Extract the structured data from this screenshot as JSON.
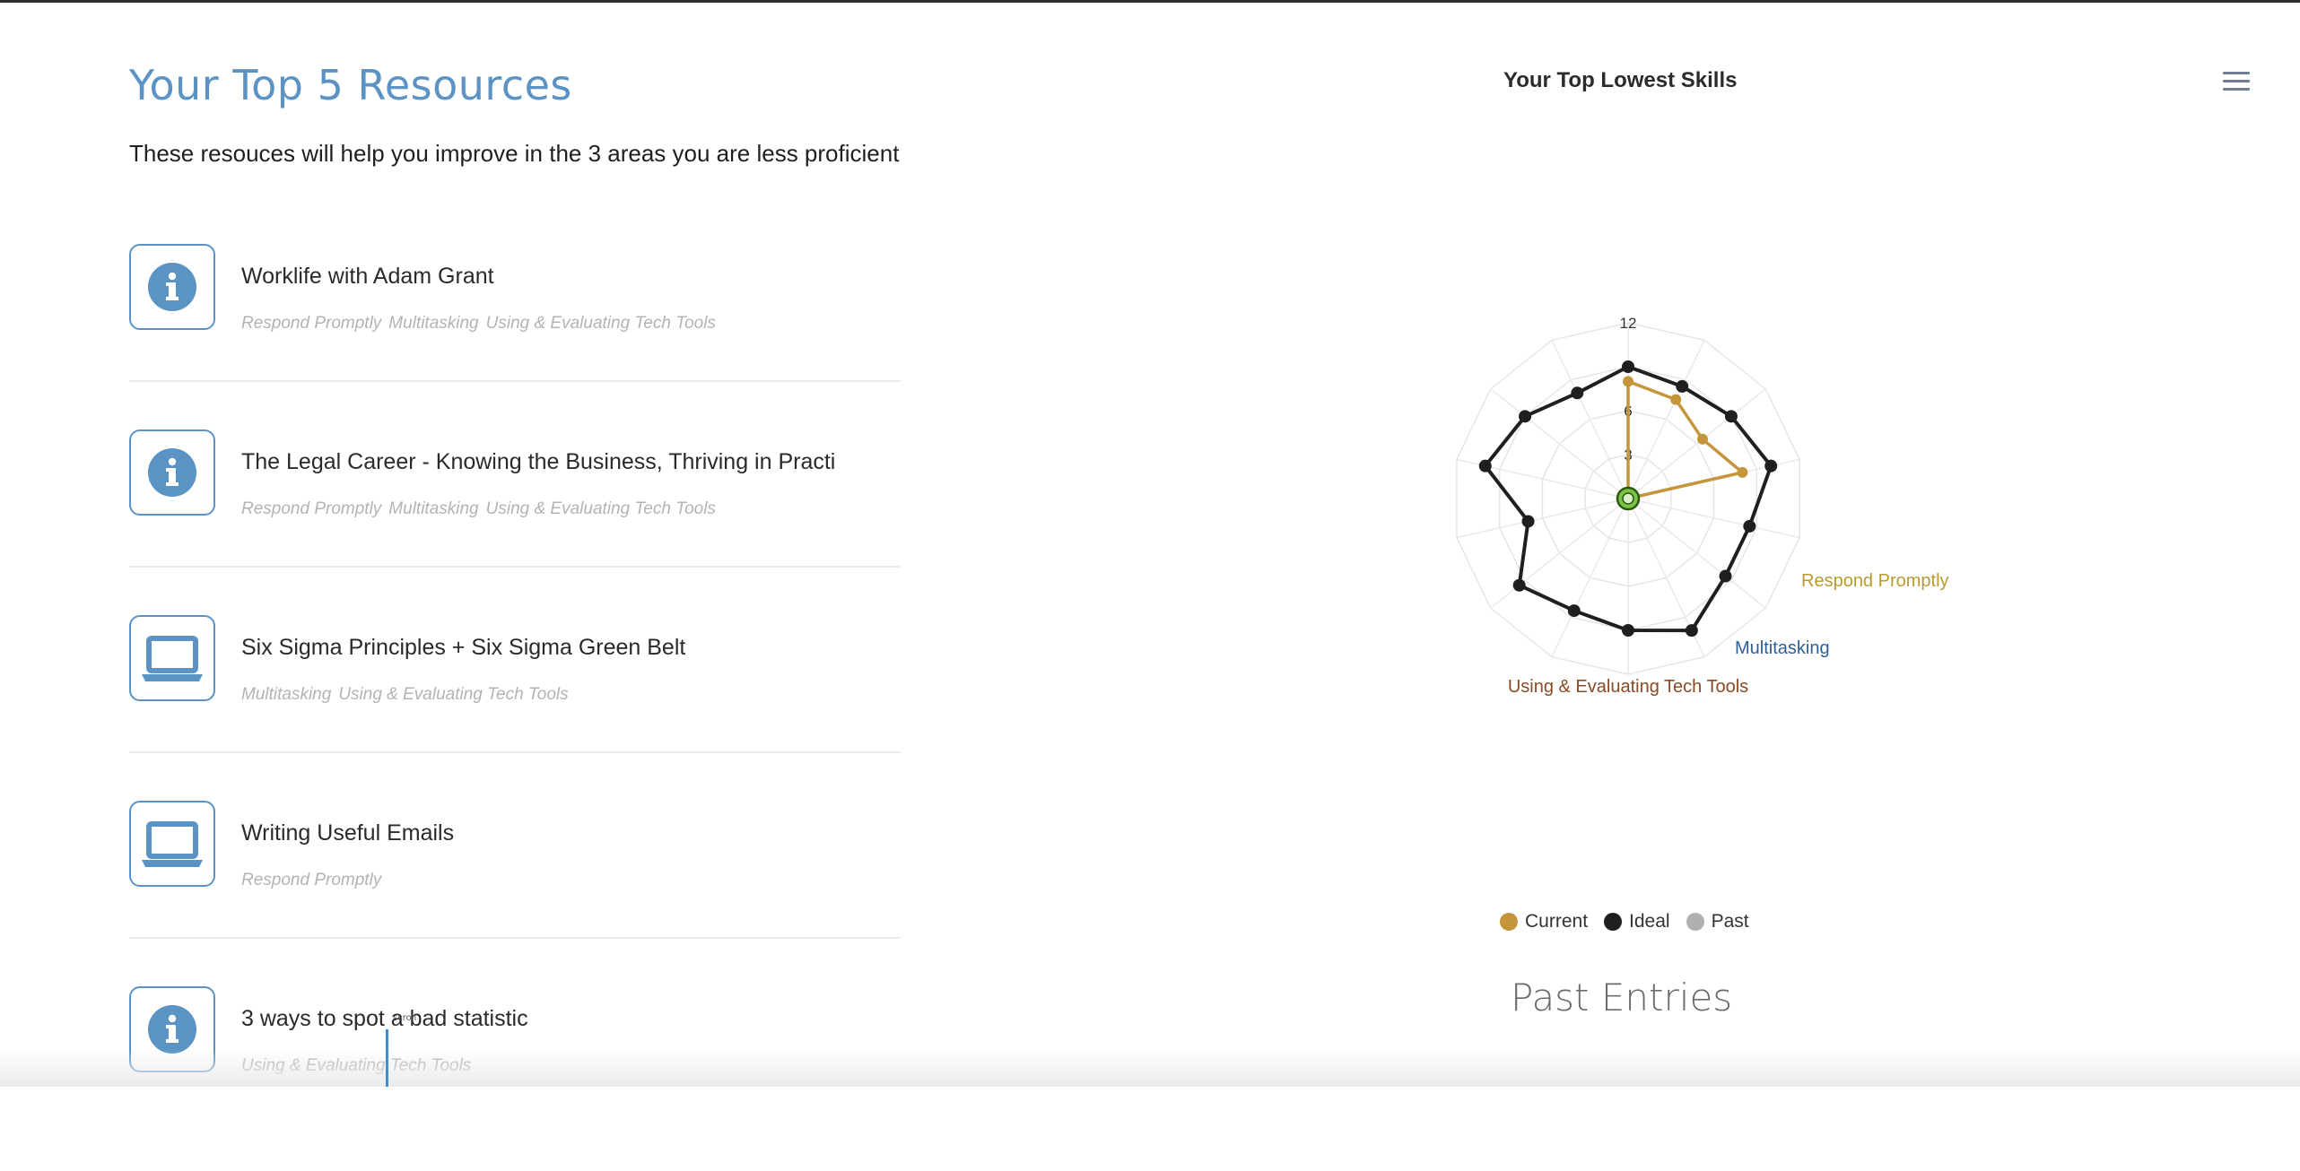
{
  "resources_section": {
    "heading": "Your Top 5 Resources",
    "subheading": "These resouces will help you improve in the 3 areas you are less proficient",
    "items": [
      {
        "icon": "info-icon",
        "title": "Worklife with Adam Grant",
        "tags": [
          "Respond Promptly",
          "Multitasking",
          "Using & Evaluating Tech Tools"
        ]
      },
      {
        "icon": "info-icon",
        "title": "The Legal Career - Knowing the Business, Thriving in Practi",
        "tags": [
          "Respond Promptly",
          "Multitasking",
          "Using & Evaluating Tech Tools"
        ]
      },
      {
        "icon": "laptop-icon",
        "title": "Six Sigma Principles + Six Sigma Green Belt",
        "tags": [
          "Multitasking",
          "Using & Evaluating Tech Tools"
        ]
      },
      {
        "icon": "laptop-icon",
        "title": "Writing Useful Emails",
        "tags": [
          "Respond Promptly"
        ]
      },
      {
        "icon": "info-icon",
        "title": "3 ways to spot a bad statistic",
        "tags": [
          "Using & Evaluating Tech Tools"
        ]
      }
    ]
  },
  "chart_panel": {
    "title": "Your Top Lowest Skills",
    "menu_icon": "hamburger-menu-icon",
    "past_entries_heading": "Past Entries",
    "cursor_label": "scroll"
  },
  "colors": {
    "accent": "#5a93c4",
    "current": "#c4953a",
    "ideal": "#1f1f1f",
    "past": "#b0b0b0",
    "respond_promptly": "#b99a2f",
    "multitasking": "#2f5f95",
    "tech_tools": "#8a4a23"
  },
  "chart_data": {
    "type": "radar",
    "scale_ticks": [
      "0",
      "3",
      "6",
      "12"
    ],
    "r_max": 12,
    "axis_count": 14,
    "axis_labels": [
      {
        "index": 3,
        "text": "Respond Promptly",
        "color": "#b99a2f"
      },
      {
        "index": 5,
        "text": "Multitasking",
        "color": "#2f5f95"
      },
      {
        "index": 7,
        "text": "Using & Evaluating Tech Tools",
        "color": "#8a4a23"
      }
    ],
    "legend": [
      "Current",
      "Ideal",
      "Past"
    ],
    "series": [
      {
        "name": "Current",
        "color": "#c4953a",
        "values": [
          8,
          7.5,
          6.5,
          8,
          0,
          0,
          0,
          0,
          0,
          0,
          0,
          0,
          0,
          0
        ],
        "closed": false
      },
      {
        "name": "Ideal",
        "color": "#1f1f1f",
        "values": [
          9,
          8.5,
          9,
          10,
          8.5,
          8.5,
          10,
          9,
          8.5,
          9.5,
          7,
          10,
          9,
          8
        ],
        "closed": true
      },
      {
        "name": "Past",
        "color": "#b0b0b0",
        "values": [],
        "closed": false
      }
    ]
  }
}
